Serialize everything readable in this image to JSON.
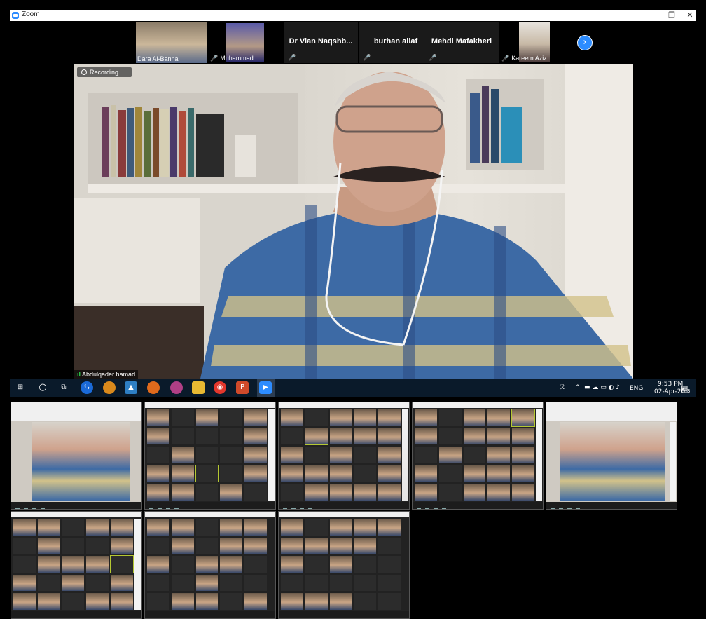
{
  "window": {
    "title": "Zoom",
    "controls": {
      "minimize": "−",
      "maximize": "❐",
      "close": "✕"
    }
  },
  "participants": [
    {
      "name": "Dara Al-Banna",
      "type": "video",
      "muted": false
    },
    {
      "name": "Muhammad",
      "type": "video",
      "muted": true
    },
    {
      "name": "Dr Vian Naqshb...",
      "type": "name",
      "muted": true
    },
    {
      "name": "burhan allaf",
      "type": "name",
      "muted": true
    },
    {
      "name": "Mehdi Mafakheri",
      "type": "name",
      "muted": true
    },
    {
      "name": "Kareem Aziz",
      "type": "video",
      "muted": true
    }
  ],
  "next_page_button": "›",
  "speaker": {
    "name": "Abdulqader hamad",
    "recording_label": "Recording..."
  },
  "taskbar": {
    "language": "ENG",
    "time": "9:53 PM",
    "date": "02-Apr-20",
    "notification_count": "3",
    "apps": [
      "start-icon",
      "cortana-icon",
      "task-view-icon",
      "teamviewer-icon",
      "chrome-canary-icon",
      "photos-icon",
      "firefox-icon",
      "taskbar-app-icon",
      "file-explorer-icon",
      "chrome-icon",
      "powerpoint-icon",
      "word-icon",
      "zoom-icon"
    ]
  },
  "colors": {
    "zoom_blue": "#2d8cff",
    "taskbar": "#0a1a2a",
    "muted_red": "#e02828",
    "audio_green": "#2bd34a"
  }
}
